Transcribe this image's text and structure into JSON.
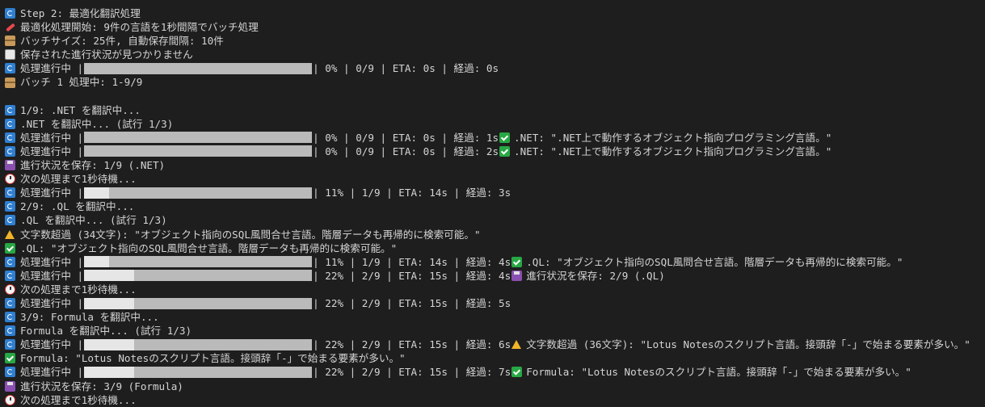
{
  "terminal": {
    "lines": [
      {
        "icon": "refresh",
        "text": "Step 2: 最適化翻訳処理"
      },
      {
        "icon": "rocket",
        "text": "最適化処理開始: 9件の言語を1秒間隔でバッチ処理"
      },
      {
        "icon": "package",
        "text": "バッチサイズ: 25件, 自動保存間隔: 10件"
      },
      {
        "icon": "doc",
        "text": "保存された進行状況が見つかりません"
      },
      {
        "icon": "refresh",
        "text": "処理進行中 |",
        "progress": 0,
        "tail": "| 0% | 0/9 | ETA: 0s | 経過: 0s"
      },
      {
        "icon": "package",
        "text": "バッチ 1 処理中: 1-9/9"
      },
      {
        "blank": true
      },
      {
        "icon": "refresh",
        "text": "1/9: .NET を翻訳中..."
      },
      {
        "icon": "refresh",
        "text": ".NET を翻訳中... (試行 1/3)"
      },
      {
        "icon": "refresh",
        "text": "処理進行中 |",
        "progress": 0,
        "tail": "| 0% | 0/9 | ETA: 0s | 経過: 1s",
        "icon2": "check",
        "text2": ".NET: \".NET上で動作するオブジェクト指向プログラミング言語。\""
      },
      {
        "icon": "refresh",
        "text": "処理進行中 |",
        "progress": 0,
        "tail": "| 0% | 0/9 | ETA: 0s | 経過: 2s",
        "icon2": "check",
        "text2": ".NET: \".NET上で動作するオブジェクト指向プログラミング言語。\""
      },
      {
        "icon": "save",
        "text": "進行状況を保存: 1/9 (.NET)"
      },
      {
        "icon": "clock",
        "text": "次の処理まで1秒待機..."
      },
      {
        "icon": "refresh",
        "text": "処理進行中 |",
        "progress": 0.11,
        "tail": "| 11% | 1/9 | ETA: 14s | 経過: 3s"
      },
      {
        "icon": "refresh",
        "text": "2/9: .QL を翻訳中..."
      },
      {
        "icon": "refresh",
        "text": ".QL を翻訳中... (試行 1/3)"
      },
      {
        "icon": "warn",
        "text": "文字数超過 (34文字): \"オブジェクト指向のSQL風問合せ言語。階層データも再帰的に検索可能。\""
      },
      {
        "icon": "check",
        "text": ".QL: \"オブジェクト指向のSQL風問合せ言語。階層データも再帰的に検索可能。\""
      },
      {
        "icon": "refresh",
        "text": "処理進行中 |",
        "progress": 0.11,
        "tail": "| 11% | 1/9 | ETA: 14s | 経過: 4s",
        "icon2": "check",
        "text2": ".QL: \"オブジェクト指向のSQL風問合せ言語。階層データも再帰的に検索可能。\""
      },
      {
        "icon": "refresh",
        "text": "処理進行中 |",
        "progress": 0.22,
        "tail": "| 22% | 2/9 | ETA: 15s | 経過: 4s",
        "icon2": "save",
        "text2": "進行状況を保存: 2/9 (.QL)"
      },
      {
        "icon": "clock",
        "text": "次の処理まで1秒待機..."
      },
      {
        "icon": "refresh",
        "text": "処理進行中 |",
        "progress": 0.22,
        "tail": "| 22% | 2/9 | ETA: 15s | 経過: 5s"
      },
      {
        "icon": "refresh",
        "text": "3/9: Formula を翻訳中..."
      },
      {
        "icon": "refresh",
        "text": "Formula を翻訳中... (試行 1/3)"
      },
      {
        "icon": "refresh",
        "text": "処理進行中 |",
        "progress": 0.22,
        "tail": "| 22% | 2/9 | ETA: 15s | 経過: 6s",
        "icon2": "warn",
        "text2": "文字数超過 (36文字): \"Lotus Notesのスクリプト言語。接頭辞「-」で始まる要素が多い。\""
      },
      {
        "icon": "check",
        "text": "Formula: \"Lotus Notesのスクリプト言語。接頭辞「-」で始まる要素が多い。\""
      },
      {
        "icon": "refresh",
        "text": "処理進行中 |",
        "progress": 0.22,
        "tail": "| 22% | 2/9 | ETA: 15s | 経過: 7s",
        "icon2": "check",
        "text2": "Formula: \"Lotus Notesのスクリプト言語。接頭辞「-」で始まる要素が多い。\""
      },
      {
        "icon": "save",
        "text": "進行状況を保存: 3/9 (Formula)"
      },
      {
        "icon": "clock",
        "text": "次の処理まで1秒待機..."
      }
    ]
  }
}
